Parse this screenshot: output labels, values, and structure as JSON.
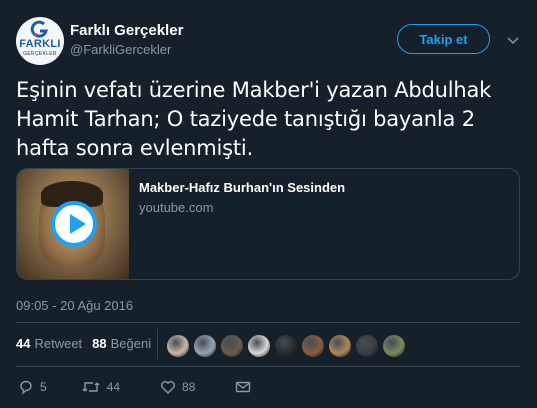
{
  "author": {
    "name": "Farklı Gerçekler",
    "handle": "@FarkliGercekler",
    "avatar_word": "FARKLI",
    "avatar_sub": "GERÇEKLER"
  },
  "follow_button": {
    "label": "Takip et"
  },
  "tweet": {
    "text": "Eşinin vefatı üzerine Makber'i yazan Abdulhak Hamit Tarhan; O taziyede tanıştığı bayanla 2 hafta sonra evlenmişti.",
    "timestamp": "09:05 - 20 Ağu 2016"
  },
  "card": {
    "title": "Makber-Hafız Burhan'ın Sesinden",
    "domain": "youtube.com"
  },
  "stats": {
    "retweets_count": "44",
    "retweets_label": "Retweet",
    "likes_count": "88",
    "likes_label": "Beğeni"
  },
  "likers": [
    {
      "color": "#c9b8a8"
    },
    {
      "color": "#9aa4ad"
    },
    {
      "color": "#6b5a4a"
    },
    {
      "color": "#d8d8d8"
    },
    {
      "color": "#2a2a2a"
    },
    {
      "color": "#8a5c3e"
    },
    {
      "color": "#b3865a"
    },
    {
      "color": "#3c3c3c"
    },
    {
      "color": "#7a8a5a"
    }
  ],
  "actions": {
    "reply_count": "5",
    "retweet_count": "44",
    "like_count": "88"
  },
  "colors": {
    "background": "#15202b",
    "accent": "#1da1f2",
    "muted": "#8899a6",
    "border": "#38444d"
  }
}
